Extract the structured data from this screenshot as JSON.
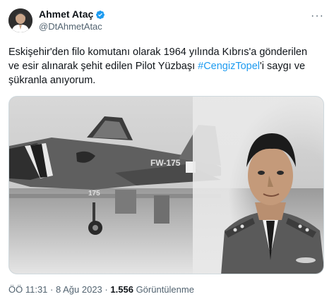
{
  "author": {
    "display_name": "Ahmet Ataç",
    "handle": "@DtAhmetAtac",
    "verified": true
  },
  "menu_icon": "more-dots-icon",
  "tweet": {
    "text_before": "Eskişehir'den filo komutanı olarak 1964 yılında Kıbrıs'a gönderilen ve esir alınarak şehit edilen Pilot Yüzbaşı ",
    "hashtag": "#CengizTopel",
    "text_after": "'i saygı ve şükranla anıyorum."
  },
  "media": {
    "aircraft_markings": [
      "FW-175",
      "175"
    ]
  },
  "meta": {
    "time": "ÖÖ 11:31",
    "separator": "·",
    "date": "8 Ağu 2023",
    "views_count": "1.556",
    "views_label": "Görüntülenme"
  },
  "colors": {
    "link": "#1d9bf0",
    "verified": "#1d9bf0",
    "secondary_text": "#536471"
  }
}
